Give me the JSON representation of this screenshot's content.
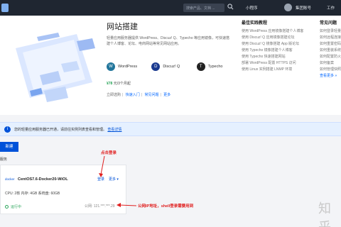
{
  "topbar": {
    "search_placeholder": "搜索产品、文档 ...",
    "items": [
      "小程序",
      "集团账号",
      "工作"
    ]
  },
  "hero": {
    "title": "网站搭建",
    "description": "轻量应用服务器提供 WordPress、Discuz! Q、Typecho 等应用镜像，可快速搭建个人博客、论坛、电商网站等常见网站应用。",
    "apps": [
      {
        "name": "WordPress",
        "icon": "wordpress-icon",
        "color": "#21759b"
      },
      {
        "name": "Discuz! Q",
        "icon": "discuz-icon",
        "color": "#1a3a8f"
      },
      {
        "name": "Typecho",
        "icon": "typecho-icon",
        "color": "#222222"
      }
    ],
    "price_value": "¥78",
    "price_suffix": " 元/3个月起",
    "links": [
      "立即选购",
      "快速入门",
      "常见问题",
      "更多"
    ]
  },
  "col1": {
    "title": "最佳实践教程",
    "items": [
      "使用 WordPress 应用镜像搭建个人博客",
      "使用 Discuz! Q 应用镜像搭建论坛",
      "使用 Discuz! Q 镜像搭建 App 版论坛",
      "使用 Typecho 镜像搭建个人博客",
      "使用 Typecho 快速搭建网站",
      "部署 WordPress 配置 HTTPS 访问",
      "使用 Linux 实例搭建 LNMP 环境"
    ]
  },
  "col2": {
    "title": "常见问题",
    "items": [
      "如何登录轻量应用服务器",
      "如何远程连接实例",
      "如何重置密码",
      "如何重装系统",
      "如何配置防火墙",
      "如何备案",
      "如何管理快照"
    ],
    "more": "查看更多 »"
  },
  "notice": {
    "text": "您的轻量应用服务器已开通，请前往实例列表查看和管理。",
    "link": "查看详情"
  },
  "new_button": "新建",
  "side_label": "服务",
  "instance": {
    "tag": "docker",
    "name": "CentOS7.6-Docker20-WiOL",
    "spec": "CPU: 2核   内存: 4GB   系统盘: 60GB",
    "status": "运行中",
    "ip": "公网: 121.***.***.29",
    "login": "登录",
    "more": "更多"
  },
  "annotations": {
    "click_login": "点击登录",
    "public_ip": "公网IP地址，shell登录需要用到"
  },
  "watermark": "知乎"
}
